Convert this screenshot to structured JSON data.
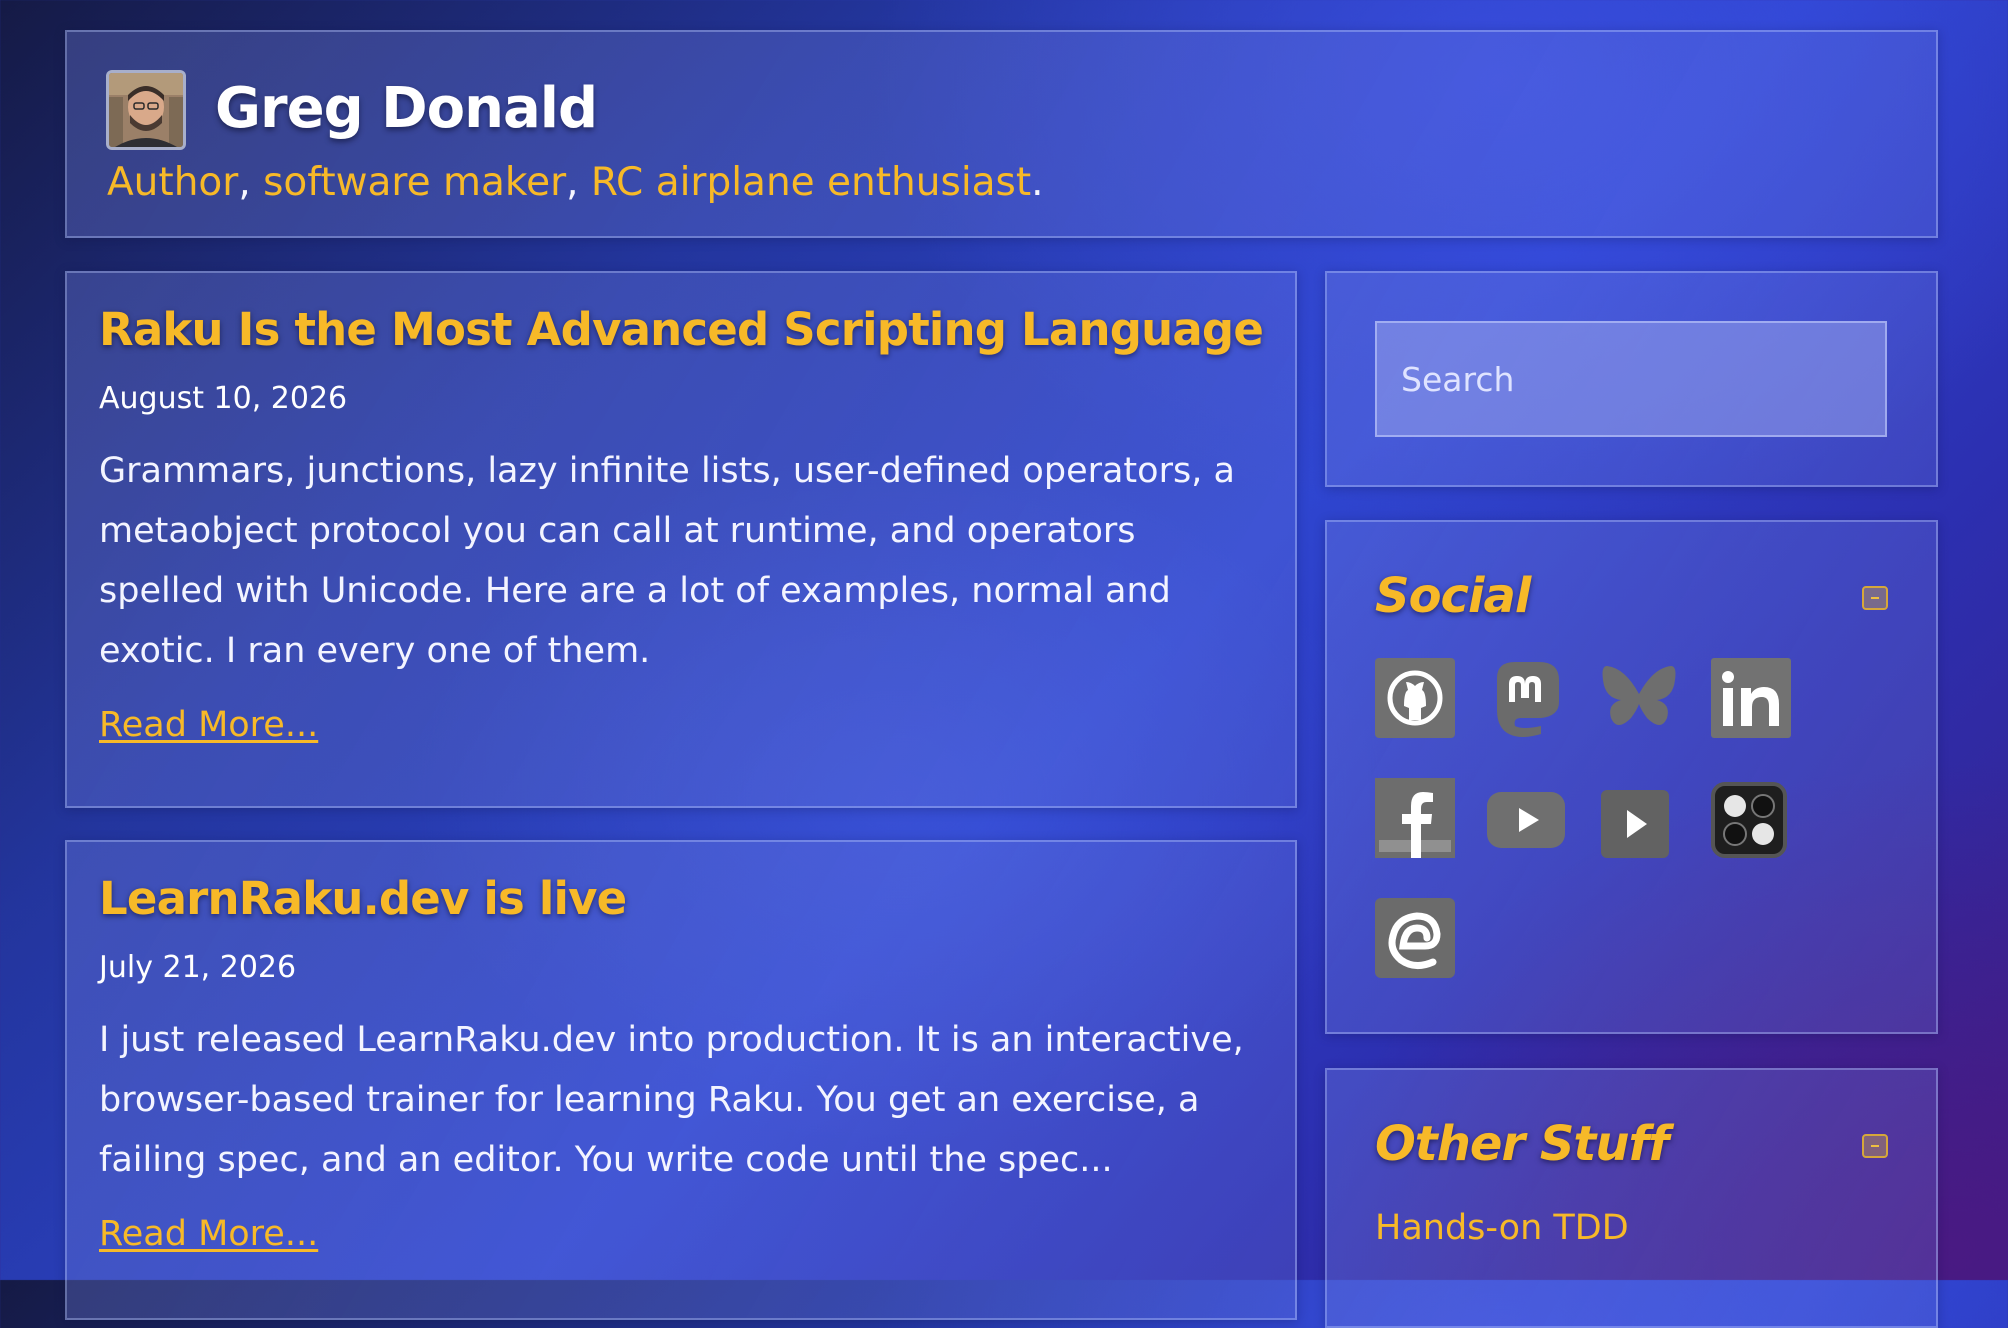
{
  "site": {
    "title": "Greg Donald",
    "tagline": {
      "author": "Author",
      "sep1": ", ",
      "maker": "software maker",
      "sep2": ", ",
      "rc": "RC airplane enthusiast",
      "end": "."
    }
  },
  "posts": [
    {
      "title": "Raku Is the Most Advanced Scripting Language",
      "date": "August 10, 2026",
      "excerpt": "Grammars, junctions, lazy infinite lists, user-defined operators, a metaobject protocol you can call at runtime, and operators spelled with Unicode. Here are a lot of examples, normal and exotic. I ran every one of them.",
      "read_more": "Read More..."
    },
    {
      "title": "LearnRaku.dev is live",
      "date": "July 21, 2026",
      "excerpt": "I just released LearnRaku.dev into production. It is an interactive, browser-based trainer for learning Raku. You get an exercise, a failing spec, and an editor. You write code until the spec...",
      "read_more": "Read More..."
    }
  ],
  "sidebar": {
    "search": {
      "placeholder": "Search"
    },
    "social": {
      "title": "Social",
      "icons": [
        "github-icon",
        "mastodon-icon",
        "bluesky-icon",
        "linkedin-icon",
        "facebook-icon",
        "youtube-icon",
        "youtube-alt-icon",
        "board-game-icon",
        "email-swirl-icon"
      ]
    },
    "other": {
      "title": "Other Stuff",
      "links": [
        "Hands-on TDD"
      ]
    }
  },
  "colors": {
    "accent": "#f7b928",
    "icon_gray": "#6e6e6e"
  }
}
